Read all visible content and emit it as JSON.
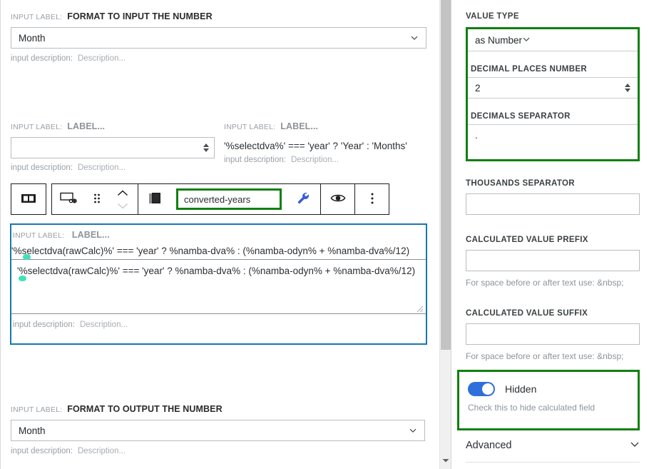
{
  "left": {
    "format_input": {
      "label_prefix": "INPUT LABEL:",
      "label": "FORMAT TO INPUT THE NUMBER",
      "select_value": "Month",
      "desc_prefix": "input description:",
      "desc_value": "Description..."
    },
    "number_field": {
      "label_prefix": "INPUT LABEL:",
      "label": "LABEL...",
      "value": "",
      "desc_prefix": "input description:",
      "desc_value": "Description..."
    },
    "expression_field": {
      "label_prefix": "INPUT LABEL:",
      "label": "LABEL...",
      "value": "'%selectdva%' === 'year' ? 'Year' : 'Months'",
      "desc_prefix": "input description:",
      "desc_value": "Description..."
    },
    "toolbar": {
      "layout_icon": "two-column-layout-icon",
      "link_icon": "link-settings-icon",
      "drag_icon": "drag-handle-icon",
      "move_up_icon": "chevron-up-icon",
      "move_down_icon": "chevron-down-icon",
      "duplicate_icon": "duplicate-icon",
      "field_name": "converted-years",
      "wrench_icon": "wrench-icon",
      "eye_icon": "eye-icon",
      "more_icon": "more-vertical-icon"
    },
    "calc_field": {
      "label_prefix": "INPUT LABEL:",
      "label": "LABEL...",
      "line1": "'%selectdva(rawCalc)%' === 'year' ? %namba-dva% : (%namba-odyn% + %namba-dva%/12)",
      "textarea_value": "'%selectdva(rawCalc)%' === 'year' ? %namba-dva% : (%namba-odyn% + %namba-dva%/12)",
      "desc_prefix": "input description:",
      "desc_value": "Description..."
    },
    "format_output": {
      "label_prefix": "INPUT LABEL:",
      "label": "FORMAT TO OUTPUT THE NUMBER",
      "select_value": "Month",
      "desc_prefix": "input description:",
      "desc_value": "Description..."
    }
  },
  "right": {
    "value_type_label": "VALUE TYPE",
    "value_type_value": "as Number",
    "decimal_places_label": "DECIMAL PLACES NUMBER",
    "decimal_places_value": "2",
    "decimals_separator_label": "DECIMALS SEPARATOR",
    "decimals_separator_value": ".",
    "thousands_separator_label": "THOUSANDS SEPARATOR",
    "thousands_separator_value": "",
    "prefix_label": "CALCULATED VALUE PREFIX",
    "prefix_value": "",
    "prefix_help": "For space before or after text use: &nbsp;",
    "suffix_label": "CALCULATED VALUE SUFFIX",
    "suffix_value": "",
    "suffix_help": "For space before or after text use: &nbsp;",
    "hidden_toggle_label": "Hidden",
    "hidden_help": "Check this to hide calculated field",
    "advanced_label": "Advanced",
    "advanced_chevron_icon": "chevron-down-icon"
  },
  "colors": {
    "highlight_green": "#108010",
    "focus_blue": "#1677b3",
    "toggle_blue": "#2f6fdb",
    "wrench_blue": "#3b5bdb",
    "cursor_teal": "#41e0bb"
  }
}
